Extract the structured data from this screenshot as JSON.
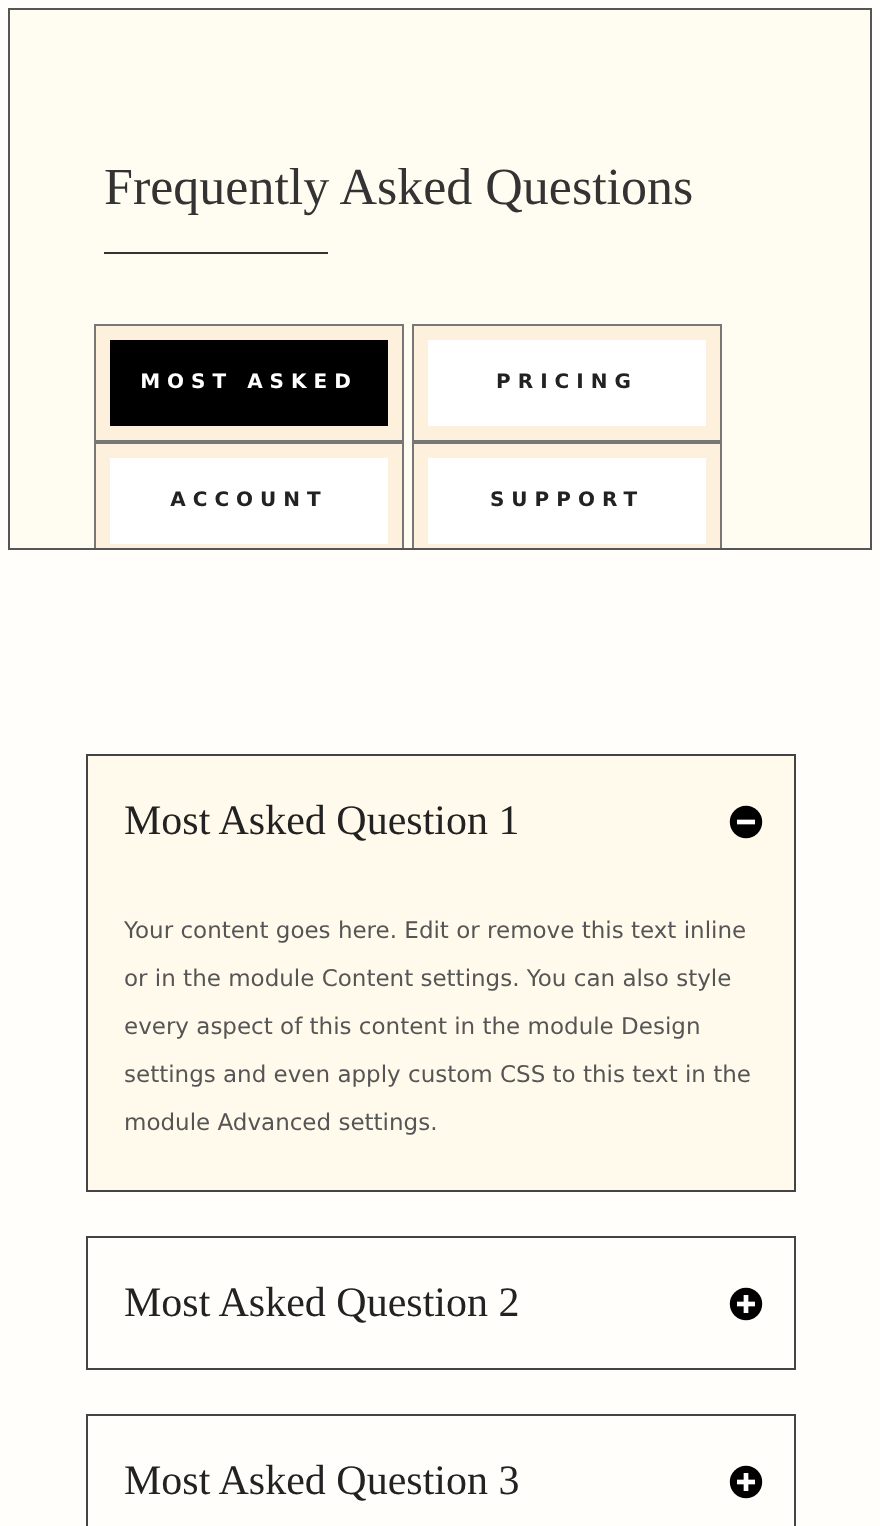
{
  "title": "Frequently Asked Questions",
  "tabs": [
    {
      "label": "MOST ASKED",
      "selected": true
    },
    {
      "label": "PRICING",
      "selected": false
    },
    {
      "label": "ACCOUNT",
      "selected": false
    },
    {
      "label": "SUPPORT",
      "selected": false
    }
  ],
  "questions": [
    {
      "title": "Most Asked Question 1",
      "expanded": true,
      "answer": "Your content goes here. Edit or remove this text inline or in the module Content settings. You can also style every aspect of this content in the module Design settings and even apply custom CSS to this text in the module Advanced settings."
    },
    {
      "title": "Most Asked Question 2",
      "expanded": false
    },
    {
      "title": "Most Asked Question 3",
      "expanded": false
    }
  ]
}
